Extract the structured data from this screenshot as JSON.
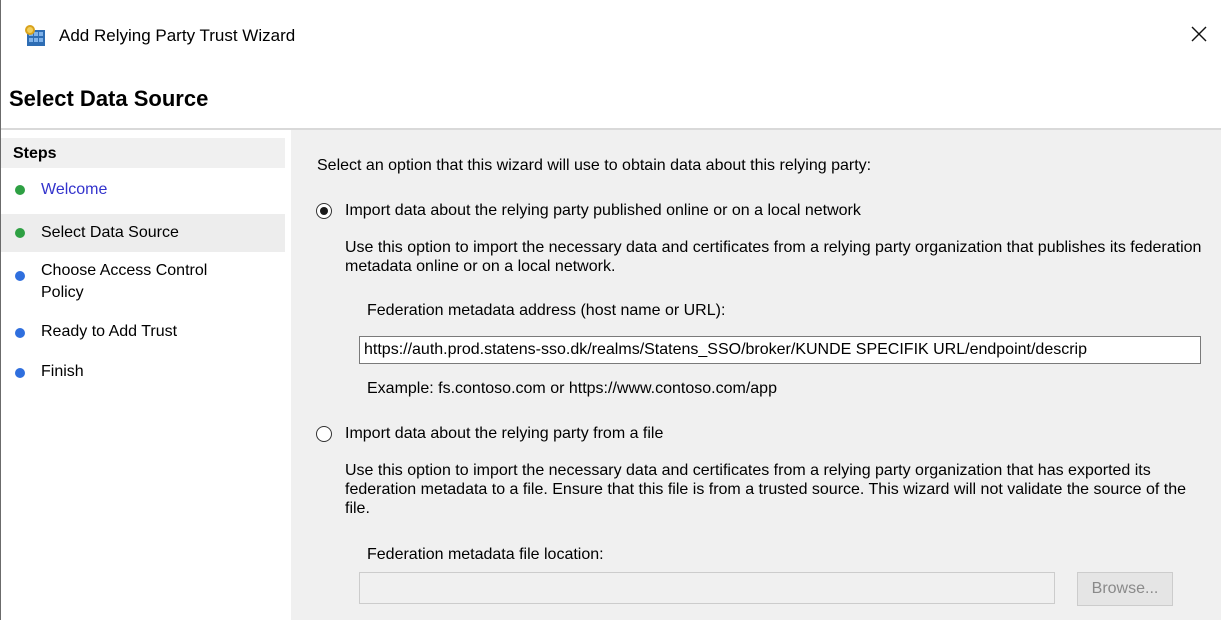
{
  "window": {
    "title": "Add Relying Party Trust Wizard",
    "close_glyph": "✕"
  },
  "header": {
    "page_title": "Select Data Source"
  },
  "steps": {
    "heading": "Steps",
    "items": [
      {
        "label": "Welcome",
        "status": "done",
        "color": "#2ea043",
        "text_color": "#3333cc"
      },
      {
        "label": "Select Data Source",
        "status": "current",
        "color": "#2ea043",
        "text_color": "#000000"
      },
      {
        "label": "Choose Access Control Policy",
        "status": "pending",
        "color": "#2f6fde",
        "text_color": "#000000"
      },
      {
        "label": "Ready to Add Trust",
        "status": "pending",
        "color": "#2f6fde",
        "text_color": "#000000"
      },
      {
        "label": "Finish",
        "status": "pending",
        "color": "#2f6fde",
        "text_color": "#000000"
      }
    ]
  },
  "main": {
    "intro": "Select an option that this wizard will use to obtain data about this relying party:",
    "option_online": {
      "label": "Import data about the relying party published online or on a local network",
      "selected": true,
      "description": "Use this option to import the necessary data and certificates from a relying party organization that publishes its federation metadata online or on a local network.",
      "field_label": "Federation metadata address (host name or URL):",
      "field_value": "https://auth.prod.statens-sso.dk/realms/Statens_SSO/broker/KUNDE SPECIFIK URL/endpoint/descrip",
      "example": "Example: fs.contoso.com or https://www.contoso.com/app"
    },
    "option_file": {
      "label": "Import data about the relying party from a file",
      "selected": false,
      "description": "Use this option to import the necessary data and certificates from a relying party organization that has exported its federation metadata to a file. Ensure that this file is from a trusted source.  This wizard will not validate the source of the file.",
      "field_label": "Federation metadata file location:",
      "field_value": "",
      "browse_label": "Browse..."
    }
  }
}
